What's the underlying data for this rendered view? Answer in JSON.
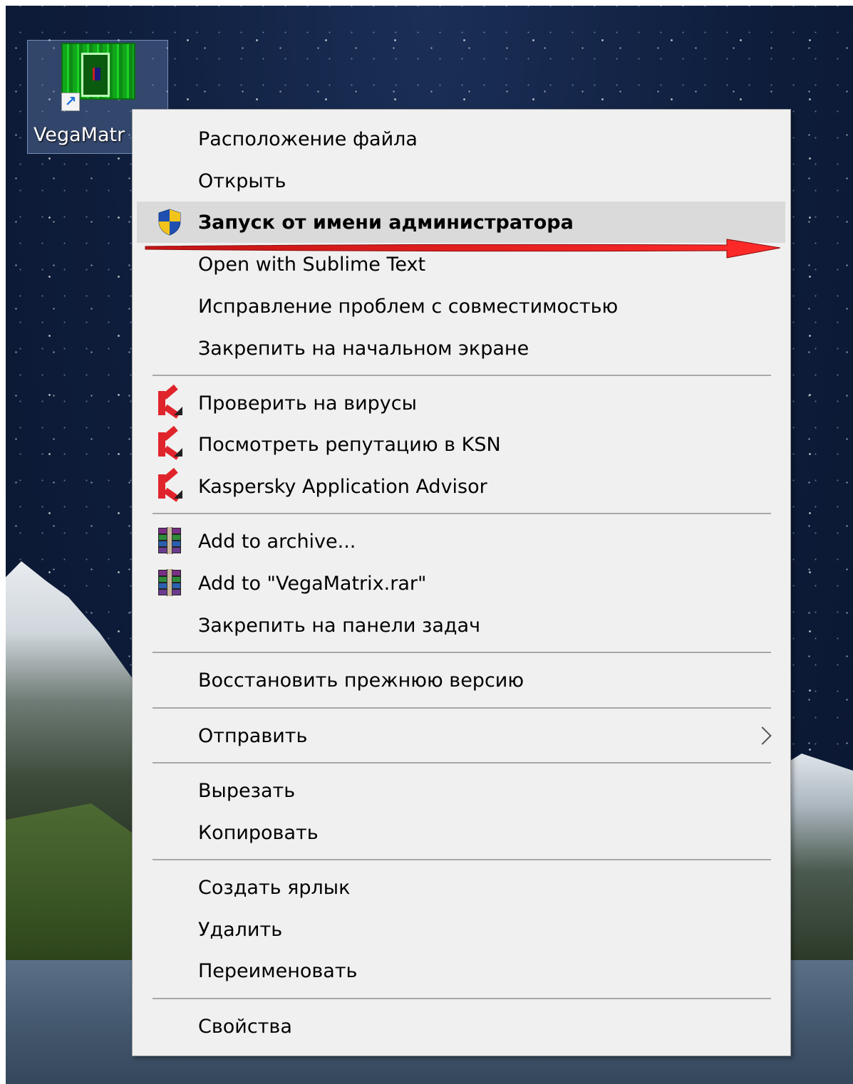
{
  "desktop": {
    "icon": {
      "label": "VegaMatr",
      "icon_name": "vegamatrix-app-icon",
      "shortcut_icon": "shortcut-arrow-icon"
    }
  },
  "context_menu": {
    "items": [
      {
        "label": "Расположение файла"
      },
      {
        "label": "Открыть"
      },
      {
        "label": "Запуск от имени администратора",
        "icon": "uac-shield-icon",
        "bold": true,
        "highlighted": true
      },
      {
        "label": "Open with Sublime Text"
      },
      {
        "label": "Исправление проблем с совместимостью"
      },
      {
        "label": "Закрепить на начальном экране"
      },
      {
        "label": "Проверить на вирусы",
        "icon": "kaspersky-icon"
      },
      {
        "label": "Посмотреть репутацию в KSN",
        "icon": "kaspersky-icon"
      },
      {
        "label": "Kaspersky Application Advisor",
        "icon": "kaspersky-icon"
      },
      {
        "label": "Add to archive...",
        "icon": "winrar-icon"
      },
      {
        "label": "Add to \"VegaMatrix.rar\"",
        "icon": "winrar-icon"
      },
      {
        "label": "Закрепить на панели задач"
      },
      {
        "label": "Восстановить прежнюю версию"
      },
      {
        "label": "Отправить",
        "submenu": true
      },
      {
        "label": "Вырезать"
      },
      {
        "label": "Копировать"
      },
      {
        "label": "Создать ярлык"
      },
      {
        "label": "Удалить"
      },
      {
        "label": "Переименовать"
      },
      {
        "label": "Свойства"
      }
    ]
  },
  "colors": {
    "menu_background": "#f0f0f0",
    "highlight": "#dadada",
    "separator": "#a8a8a8",
    "annotation_arrow": "#e01b1b",
    "kaspersky_red": "#e0242b"
  }
}
